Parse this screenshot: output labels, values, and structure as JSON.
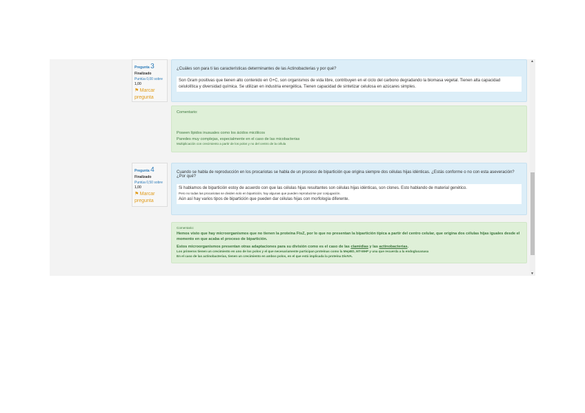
{
  "questions": [
    {
      "label": "Pregunta",
      "number": "3",
      "state": "Finalizado",
      "grade_label": "Puntúa 0,00 sobre",
      "grade": "1,00",
      "flag": "Marcar pregunta",
      "text": "¿Cuáles son para ti las características determinantes de las Actinobacterias y por qué?",
      "answer": [
        "Son Gram positivas que tienen alto contenido en G+C, son organismos de vida libre, contribuyen en el ciclo del carbono degradando la biomasa vegetal. Tienen alta capacidad celulolítica y diversidad química. Se utilizan en industria energética. Tienen capacidad de sintetizar celulosa en azúcares simples."
      ],
      "comment_label": "Comentario:",
      "comment": [
        "Poseen lípidos inusuales como los ácidos micólicos",
        "Paredes muy complejas, especialmente en el caso de las micobacterias",
        "Multiplicación con crecimiento a partir de los polos y no del centro de la célula"
      ]
    },
    {
      "label": "Pregunta",
      "number": "4",
      "state": "Finalizado",
      "grade_label": "Puntúa 0,50 sobre",
      "grade": "1,00",
      "flag": "Marcar pregunta",
      "text": "Cuando se habla de reproducción en los procariotas se habla de un proceso de bipartición que origina siempre dos células hijas idénticas. ¿Estás conforme o no con esta aseveración? ¿Por qué?",
      "answer": [
        "Si hablamos de bipartición estoy de acuerdo con que las células hijas resultantes son células hijas idénticas, son clones. Esto hablando de material genético.",
        "Pero no todas las procariotas se dividen solo en bipartición, hay algunas que pueden reproducirse por conjugación.",
        "Aún así hay varios tipos de bipartición que pueden dar células hijas con morfología diferente."
      ],
      "comment_label": "Comentario:",
      "comment": [
        "Hemos visto que hay microorganismos que no tienen la proteína FtsZ, por lo que no presentan la bipartición típica a partir del centro celular, que origina dos células hijas iguales desde el momento en que acaba el proceso de bipartición.",
        "Estos microorganismos presentan otras adaptaciones para su división como es el caso de las",
        "clamidias",
        "y las",
        "actinobacterias",
        "Los primeros tienen un crecimiento en uno de los polos y el que necesariamente participan proteínas como la MepBD, MT-MHP y una que recuerda a la endoglucanasa",
        "En el caso de las actinobacterias, tienen un crecimiento en ambos polos, en el que está implicada la proteína DivIVA."
      ]
    }
  ]
}
